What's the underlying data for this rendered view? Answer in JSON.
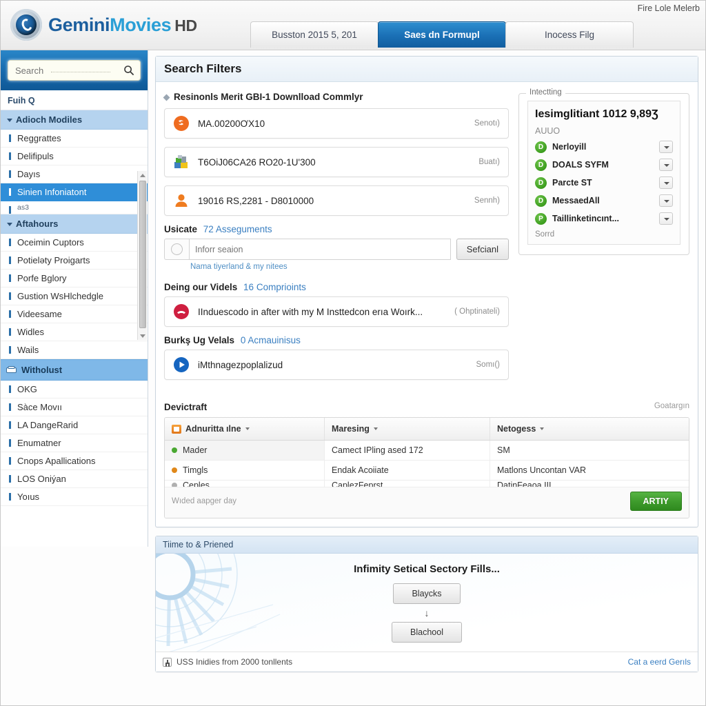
{
  "brand": {
    "part1": "Gemini",
    "part2": "Movies",
    "part3": "HD",
    "logo_icon": "swirl-logo-icon"
  },
  "header": {
    "account_label": "Fire Lole Melerb",
    "tabs": [
      {
        "label": "Busston 2015 5, 201",
        "active": false
      },
      {
        "label": "Saes dn Formupl",
        "active": true
      },
      {
        "label": "Inocess Filg",
        "active": false
      }
    ]
  },
  "sidebar": {
    "search": {
      "value": "",
      "placeholder": "Search"
    },
    "top_label": "Fuih Q",
    "group_label": "Adioch Modiles",
    "items": [
      {
        "label": "Reggrattes",
        "selected": false
      },
      {
        "label": "Delifipuls",
        "selected": false
      },
      {
        "label": "Dayıs",
        "selected": false
      },
      {
        "label": "Sinien Infoniatont",
        "selected": true
      },
      {
        "label": "as3",
        "selected": false,
        "small": true
      }
    ],
    "group2_label": "Aftahours",
    "items2": [
      {
        "label": "Oceimin Cuptors"
      },
      {
        "label": "Potieləty Proigarts"
      },
      {
        "label": "Porfe Bglory"
      },
      {
        "label": "Gustion WsHlchedgle"
      },
      {
        "label": "Videesame"
      },
      {
        "label": "Widles"
      },
      {
        "label": "Wails"
      }
    ],
    "section_label": "Witholust",
    "items3": [
      {
        "label": "OKG"
      },
      {
        "label": "Sàce Movıı"
      },
      {
        "label": "LA DangeRarid"
      },
      {
        "label": "Enumatner"
      },
      {
        "label": "Cnops Apallications"
      },
      {
        "label": "LOS Oniýan"
      },
      {
        "label": "Yoıus"
      }
    ]
  },
  "main": {
    "panel_title": "Search Filters",
    "section1_heading": "Resinonls Merit GBI-1 Downlload Commlyr",
    "rows": [
      {
        "text": "MA.00200ƠX10",
        "meta": "Senotı)",
        "icon": "orange-swirl-icon"
      },
      {
        "text": "T6OiJ06CA26 RO20-1U'300",
        "meta": "Buatı)",
        "icon": "multicolor-folder-icon"
      },
      {
        "text": "19016 RS,2281 - D8010000",
        "meta": "Sennh)",
        "icon": "orange-person-icon"
      }
    ],
    "usicate": {
      "label": "Usicate",
      "count": "72 Asseguments",
      "input_value": "",
      "input_placeholder": "Inforr seaion",
      "button_label": "Sefcianl",
      "hint": "Nama tiyerland & my nitees"
    },
    "videls": {
      "label": "Deing our Videls",
      "count": "16 Comprioints",
      "row": {
        "text": "IInduescodo in after with my M Insttedcon erıa Woırk...",
        "meta": "( Ohptinateli)",
        "icon": "red-phone-icon"
      }
    },
    "burks": {
      "label": "Burkş Ug Velals",
      "count": "0 Acmauinisus",
      "row": {
        "text": "iMthnagezpoplalizud",
        "meta": "Somı()",
        "icon": "blue-play-icon"
      }
    },
    "right_panel": {
      "legend": "Intectting",
      "title": "Iesimglitiant 1012 9,89Ʒ",
      "subtitle": "AUUO",
      "items": [
        {
          "badge": "D",
          "label": "Nerloyill"
        },
        {
          "badge": "D",
          "label": "DOALS SYFM"
        },
        {
          "badge": "D",
          "label": "Parcte ST"
        },
        {
          "badge": "D",
          "label": "MessaedAll"
        },
        {
          "badge": "P",
          "label": "Taillinketincınt..."
        }
      ],
      "footer": "Sorrd"
    },
    "table": {
      "title": "Devictraft",
      "top_right": "Goatargın",
      "columns": [
        "Adnuritta ılne",
        "Maresing",
        "Netogess"
      ],
      "rows": [
        {
          "c0": "Mader",
          "dot": "#4aa832",
          "c1": "Camect IPling ased 172",
          "c2": "SM"
        },
        {
          "c0": "Timgls",
          "dot": "#e0881a",
          "c1": "Endak Acoiiate",
          "c2": "Matlons Uncontan VAR"
        },
        {
          "c0": "Ceples",
          "dot": "#b0b0b0",
          "c1": "CaplezFeprst",
          "c2": "DatinFeaoa III"
        }
      ],
      "footer_text": "Wıded aapger day",
      "apply_label": "ARTIY"
    },
    "promo": {
      "head": "Tiime to & Priened",
      "title": "Infimity Setical Sectory Fills...",
      "button1": "Blaycks",
      "arrow": "↓",
      "button2": "Blachool",
      "foot_left": "USS Inidies from 2000 tonllents",
      "foot_right": "Cat a eerd Gerıls"
    }
  },
  "colors": {
    "accent_blue": "#1a6fb5",
    "green": "#3d9a2b",
    "orange": "#e0761a",
    "link": "#3a7fc1"
  }
}
